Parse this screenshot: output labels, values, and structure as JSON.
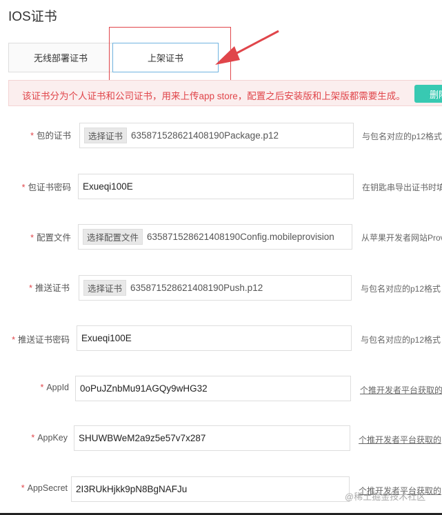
{
  "page": {
    "title": "IOS证书"
  },
  "tabs": [
    {
      "label": "无线部署证书"
    },
    {
      "label": "上架证书"
    }
  ],
  "notice": {
    "text": "该证书分为个人证书和公司证书，用来上传app store，配置之后安装版和上架版都需要生成。",
    "button_label": "删除"
  },
  "form": {
    "required_mark": "*",
    "rows": [
      {
        "label": "包的证书",
        "button": "选择证书",
        "value": "635871528621408190Package.p12",
        "hint": "与包名对应的p12格式"
      },
      {
        "label": "包证书密码",
        "value": "Exueqi100E",
        "hint": "在钥匙串导出证书时填"
      },
      {
        "label": "配置文件",
        "button": "选择配置文件",
        "value": "635871528621408190Config.mobileprovision",
        "hint": "从苹果开发者网站Prov"
      },
      {
        "label": "推送证书",
        "button": "选择证书",
        "value": "635871528621408190Push.p12",
        "hint": "与包名对应的p12格式"
      },
      {
        "label": "推送证书密码",
        "value": "Exueqi100E",
        "hint": "与包名对应的p12格式"
      },
      {
        "label": "AppId",
        "value": "0oPuJZnbMu91AGQy9wHG32",
        "hint": "个推开发者平台获取的"
      },
      {
        "label": "AppKey",
        "value": "SHUWBWeM2a9z5e57v7x287",
        "hint": "个推开发者平台获取的"
      },
      {
        "label": "AppSecret",
        "value": "2I3RUkHjkk9pN8BgNAFJu",
        "hint": "个推开发者平台获取的"
      }
    ]
  },
  "watermark": "@稀土掘金技术社区",
  "colors": {
    "accent_red": "#e0454a",
    "active_tab_border": "#6fb3e0",
    "delete_button": "#38c9b2"
  }
}
